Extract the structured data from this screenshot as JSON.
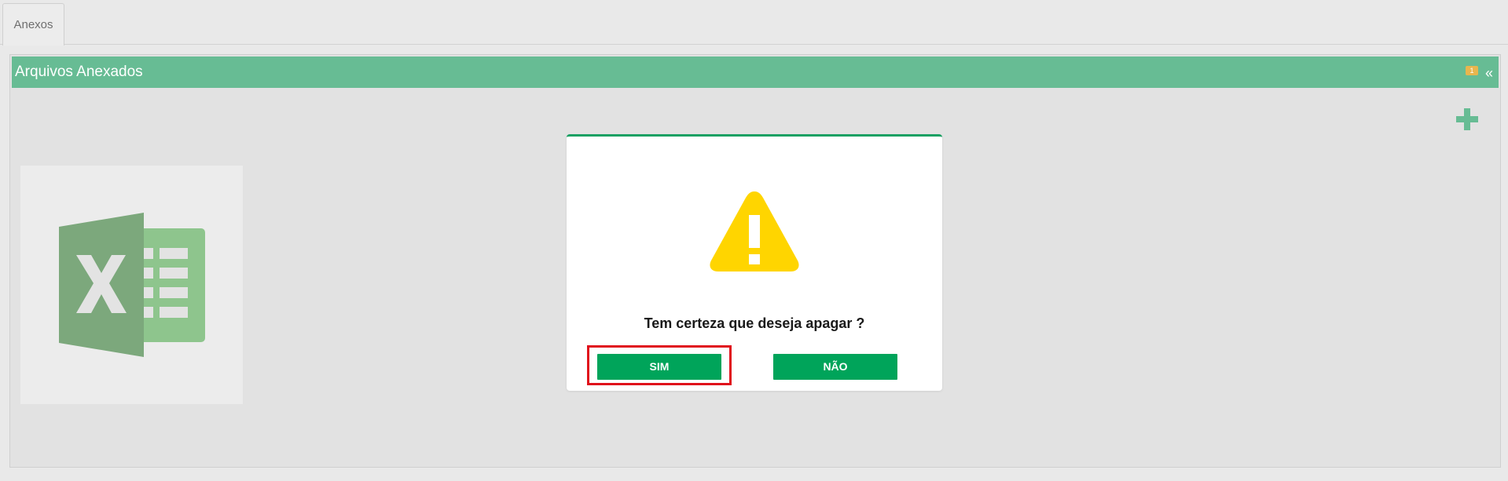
{
  "tabs": [
    {
      "label": "Anexos"
    }
  ],
  "panel": {
    "title": "Arquivos Anexados",
    "badge_count": "1",
    "collapse_glyph": "«",
    "add_icon": "plus-icon"
  },
  "files": [
    {
      "icon": "excel-file-icon"
    }
  ],
  "dialog": {
    "icon": "warning-icon",
    "message": "Tem certeza que deseja apagar ?",
    "confirm_label": "SIM",
    "cancel_label": "NÃO"
  },
  "colors": {
    "header": "#67bc94",
    "button": "#00a45a",
    "warning": "#ffd500",
    "highlight": "#e0101b",
    "badge": "#e8b64e"
  }
}
